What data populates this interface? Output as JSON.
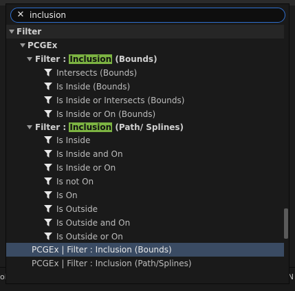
{
  "search": {
    "value": "inclusion",
    "clear_icon": "close-icon"
  },
  "category": {
    "label": "Filter"
  },
  "group": {
    "label": "PCGEx"
  },
  "sections": [
    {
      "prefix": "Filter : ",
      "highlight": "Inclusion",
      "suffix": " (Bounds)",
      "items": [
        "Intersects (Bounds)",
        "Is Inside (Bounds)",
        "Is Inside or Intersects (Bounds)",
        "Is Inside or On (Bounds)"
      ]
    },
    {
      "prefix": "Filter : ",
      "highlight": "Inclusion",
      "suffix": " (Path/ Splines)",
      "items": [
        "Is Inside",
        "Is Inside and On",
        "Is Inside or On",
        "Is not On",
        "Is On",
        "Is Outside",
        "Is Outside and On",
        "Is Outside or On"
      ]
    }
  ],
  "results": [
    "PCGEx | Filter : Inclusion (Bounds)",
    "PCGEx | Filter : Inclusion (Path/Splines)"
  ],
  "background": {
    "left_text": "oir",
    "right_text": "N"
  },
  "colors": {
    "highlight": "#7cb342",
    "selection": "#3a4b63",
    "search_border": "#2f6fcf"
  }
}
